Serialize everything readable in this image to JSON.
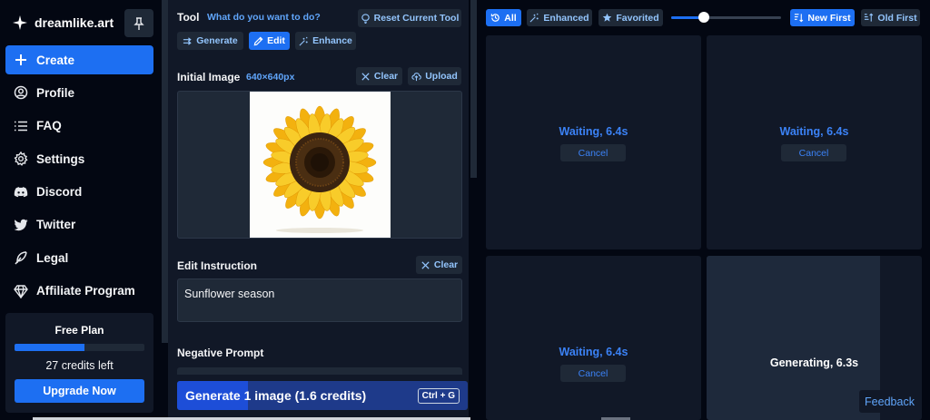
{
  "brand": {
    "name": "dreamlike.art"
  },
  "nav": [
    {
      "label": "Create",
      "icon": "plus-icon",
      "active": true
    },
    {
      "label": "Profile",
      "icon": "user-circle-icon"
    },
    {
      "label": "FAQ",
      "icon": "list-icon"
    },
    {
      "label": "Settings",
      "icon": "gear-icon"
    },
    {
      "label": "Discord",
      "icon": "discord-icon"
    },
    {
      "label": "Twitter",
      "icon": "twitter-icon"
    },
    {
      "label": "Legal",
      "icon": "feather-icon"
    },
    {
      "label": "Affiliate Program",
      "icon": "diamond-icon"
    }
  ],
  "plan": {
    "title": "Free Plan",
    "credits_text": "27 credits left",
    "upgrade_label": "Upgrade Now",
    "usage_fraction": 0.54
  },
  "tool": {
    "heading": "Tool",
    "question": "What do you want to do?",
    "reset_label": "Reset Current Tool",
    "modes": [
      {
        "label": "Generate",
        "icon": "double-arrow-icon"
      },
      {
        "label": "Edit",
        "icon": "pencil-icon",
        "active": true
      },
      {
        "label": "Enhance",
        "icon": "magic-wand-icon"
      }
    ]
  },
  "initial_image": {
    "label": "Initial Image",
    "size": "640×640px",
    "clear_label": "Clear",
    "upload_label": "Upload"
  },
  "edit_instruction": {
    "label": "Edit Instruction",
    "clear_label": "Clear",
    "value": "Sunflower season"
  },
  "negative_prompt": {
    "label": "Negative Prompt"
  },
  "generate": {
    "label": "Generate 1 image (1.6 credits)",
    "shortcut": "Ctrl + G",
    "progress_fraction": 0.243
  },
  "filters": [
    {
      "label": "All",
      "icon": "history-icon",
      "active": true
    },
    {
      "label": "Enhanced",
      "icon": "magic-wand-icon"
    },
    {
      "label": "Favorited",
      "icon": "star-icon"
    }
  ],
  "zoom_slider": {
    "value_fraction": 0.3
  },
  "sort": [
    {
      "label": "New First",
      "icon": "sort-desc-icon",
      "active": true
    },
    {
      "label": "Old First",
      "icon": "sort-asc-icon"
    }
  ],
  "results": [
    {
      "status": "Waiting, 6.4s",
      "cancel_label": "Cancel"
    },
    {
      "status": "Waiting, 6.4s",
      "cancel_label": "Cancel"
    },
    {
      "status": "Waiting, 6.4s",
      "cancel_label": "Cancel"
    },
    {
      "status": "Generating, 6.3s",
      "progress_fraction": 0.805
    }
  ],
  "feedback_label": "Feedback",
  "colors": {
    "accent": "#1d6ff2",
    "panel": "#111827",
    "background": "#030712",
    "link": "#3b82f6"
  }
}
